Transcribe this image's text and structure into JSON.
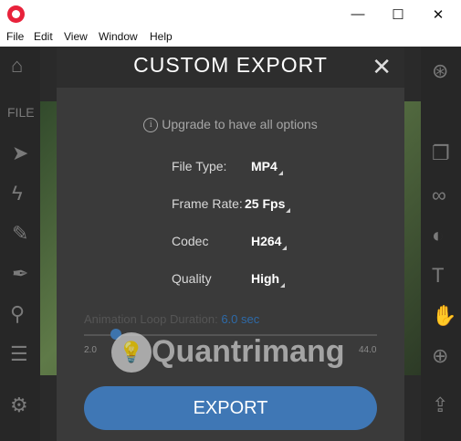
{
  "menubar": [
    "File",
    "Edit",
    "View",
    "Window",
    "Help"
  ],
  "window_controls": {
    "minimize": "—",
    "maximize": "☐",
    "close": "✕"
  },
  "left_panel_label": "FILE",
  "modal": {
    "title": "CUSTOM  EXPORT",
    "close": "✕",
    "upgrade_text": "Upgrade to have all options",
    "info_icon": "i",
    "rows": [
      {
        "label": "File Type:",
        "value": "MP4"
      },
      {
        "label": "Frame Rate:",
        "value": "25 Fps"
      },
      {
        "label": "Codec",
        "value": "H264"
      },
      {
        "label": "Quality",
        "value": "High"
      }
    ],
    "loop_label": "Animation Loop Duration:",
    "loop_value": "6.0 sec",
    "slider_min": "2.0",
    "slider_max": "44.0",
    "export_label": "EXPORT"
  },
  "watermark": "Quantrimang",
  "colors": {
    "accent": "#3f77b5",
    "app_icon": "#e8223b",
    "loop_value": "#2e6aa8"
  },
  "icons": [
    "app-logo-icon",
    "home-icon",
    "pointer-icon",
    "lightning-icon",
    "brush-icon",
    "pen-icon",
    "figure-icon",
    "sliders-icon",
    "gear-icon",
    "compass-icon",
    "layers-icon",
    "mask-icon",
    "contrast-icon",
    "text-icon",
    "hand-icon",
    "zoom-icon",
    "share-icon"
  ]
}
